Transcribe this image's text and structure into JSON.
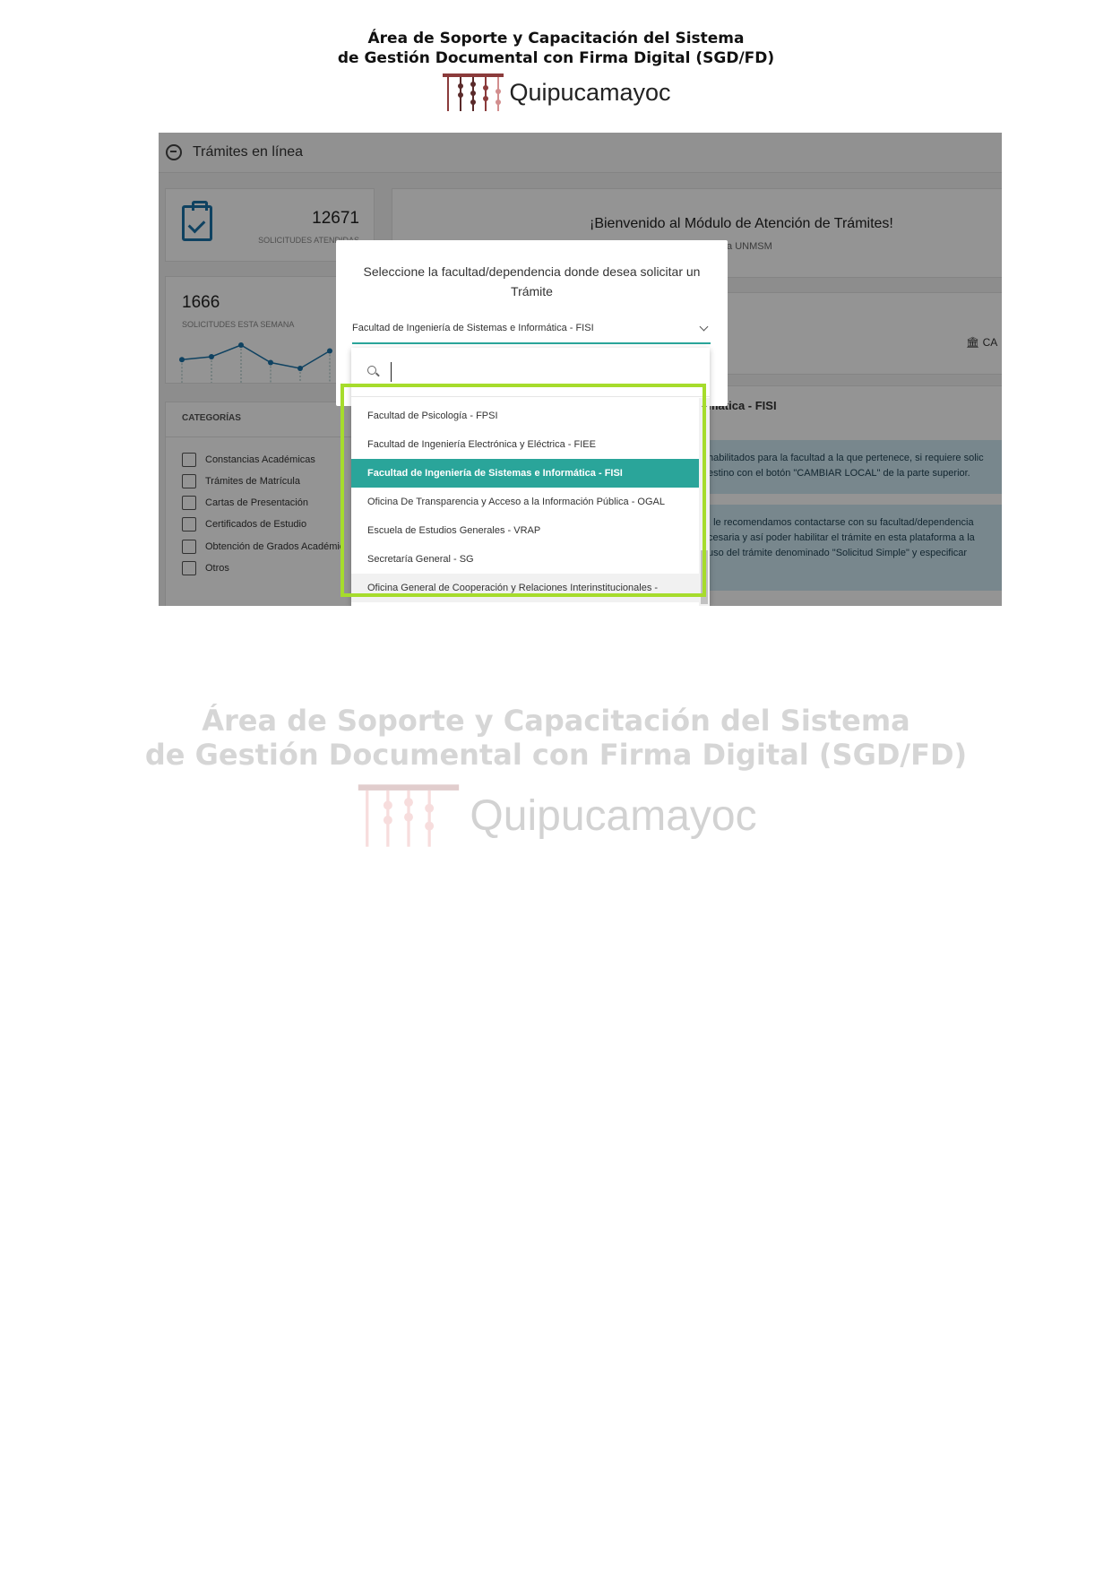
{
  "document": {
    "header_line1": "Área de Soporte y Capacitación del Sistema",
    "header_line2": "de Gestión Documental con Firma Digital (SGD/FD)",
    "logo_text": "Quipucamayoc"
  },
  "app": {
    "title": "Trámites en línea",
    "stats": {
      "attended_value": "12671",
      "attended_label": "SOLICITUDES ATENDIDAS",
      "week_value": "1666",
      "week_label": "SOLICITUDES ESTA SEMANA",
      "week_trend": [
        3,
        4,
        8,
        2,
        0,
        6
      ]
    },
    "categories": {
      "title": "CATEGORÍAS",
      "items": [
        "Constancias Académicas",
        "Trámites de Matrícula",
        "Cartas de Presentación",
        "Certificados de Estudio",
        "Obtención de Grados Académic",
        "Otros"
      ]
    },
    "welcome": {
      "title": "¡Bienvenido al Módulo de Atención de Trámites!",
      "subtitle": "ud y el seguimiento de trámites de la UNMSM"
    },
    "local_button": "CA",
    "faculty_title": "mática - FISI",
    "info1": {
      "line1": "habilitados para la facultad a la que pertenece, si requiere solic",
      "line2": "estino con el botón \"CAMBIAR LOCAL\" de la parte superior."
    },
    "info2": {
      "line1": ", le recomendamos contactarse con su facultad/dependencia",
      "line2": "cesaria y así poder habilitar el trámite en esta plataforma a la",
      "line3": "uso del trámite denominado \"Solicitud Simple\" y especificar"
    }
  },
  "modal": {
    "title": "Seleccione la facultad/dependencia donde desea solicitar un Trámite",
    "selected_value": "Facultad de Ingeniería de Sistemas e Informática - FISI",
    "search_value": "",
    "options": [
      "Facultad de Psicología - FPSI",
      "Facultad de Ingeniería Electrónica y Eléctrica - FIEE",
      "Facultad de Ingeniería de Sistemas e Informática - FISI",
      "Oficina De Transparencia y Acceso a la Información Pública - OGAL",
      "Escuela de Estudios Generales - VRAP",
      "Secretaría General - SG",
      "Oficina General de Cooperación y Relaciones Interinstitucionales -"
    ],
    "selected_index": 2
  },
  "colors": {
    "accent": "#2aa59a",
    "highlight": "#a6dc2c",
    "icon_blue": "#1a73a8",
    "logo_brown": "#8b3b3b"
  }
}
